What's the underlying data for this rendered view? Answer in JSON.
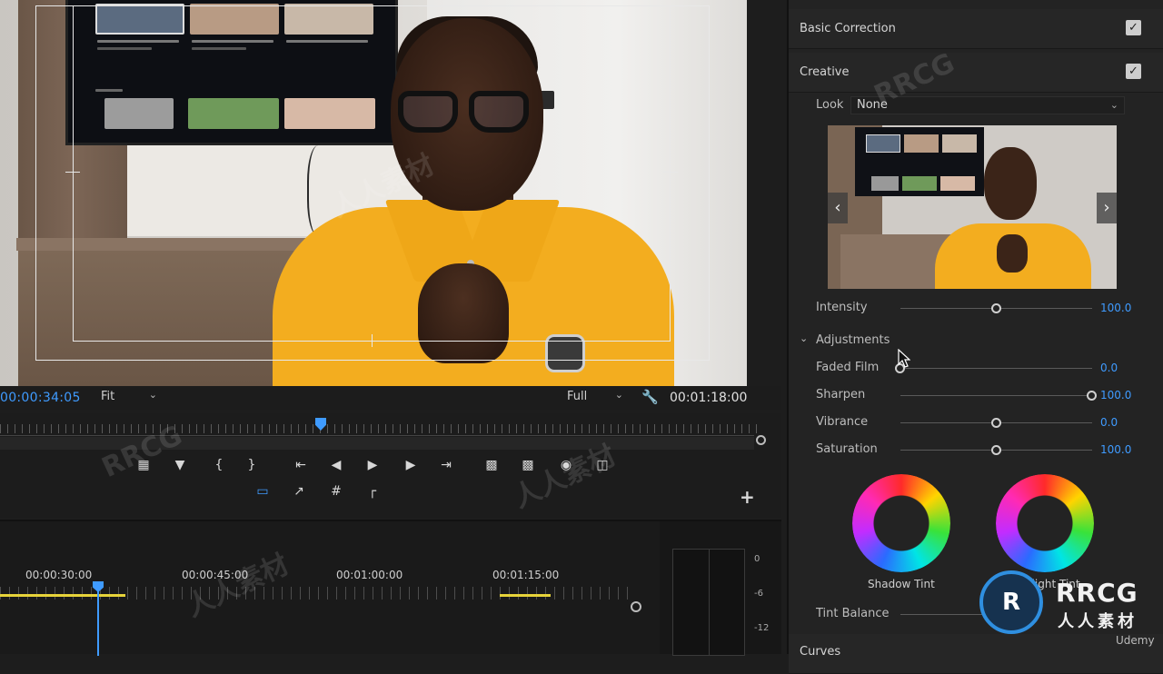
{
  "monitor": {
    "current_timecode": "00:00:34:05",
    "fit_label": "Fit",
    "quality_label": "Full",
    "duration_timecode": "00:01:18:00"
  },
  "transport": {
    "buttons": [
      "marker-icon",
      "add-marker-icon",
      "mark-in-icon",
      "mark-out-icon",
      "go-to-in-icon",
      "step-back-icon",
      "play-icon",
      "step-forward-icon",
      "go-to-out-icon",
      "insert-icon",
      "overwrite-icon",
      "export-frame-icon",
      "compare-icon",
      "safe-margins-icon",
      "lift-icon",
      "grid-icon",
      "crop-icon"
    ]
  },
  "timeline": {
    "labels": [
      "00:00:30:00",
      "00:00:45:00",
      "00:01:00:00",
      "00:01:15:00"
    ]
  },
  "meter": {
    "labels": [
      "0",
      "-6",
      "-12"
    ]
  },
  "lumetri": {
    "basic_correction": "Basic Correction",
    "creative": "Creative",
    "look_label": "Look",
    "look_value": "None",
    "intensity_label": "Intensity",
    "intensity_value": "100.0",
    "adjustments_label": "Adjustments",
    "faded_film_label": "Faded Film",
    "faded_film_value": "0.0",
    "sharpen_label": "Sharpen",
    "sharpen_value": "100.0",
    "vibrance_label": "Vibrance",
    "vibrance_value": "0.0",
    "saturation_label": "Saturation",
    "saturation_value": "100.0",
    "shadow_tint_label": "Shadow Tint",
    "highlight_tint_label": "Highlight Tint",
    "tint_balance_label": "Tint Balance",
    "curves_label": "Curves",
    "sliders": {
      "intensity": 0.5,
      "faded_film": 0.0,
      "sharpen": 1.0,
      "vibrance": 0.5,
      "saturation": 0.5
    }
  },
  "watermark": {
    "brand": "RRCG",
    "brand_sub": "人人素材",
    "udemy": "Udemy"
  },
  "colors": {
    "accent": "#3f9bff",
    "shirt": "#f3ad1f"
  }
}
